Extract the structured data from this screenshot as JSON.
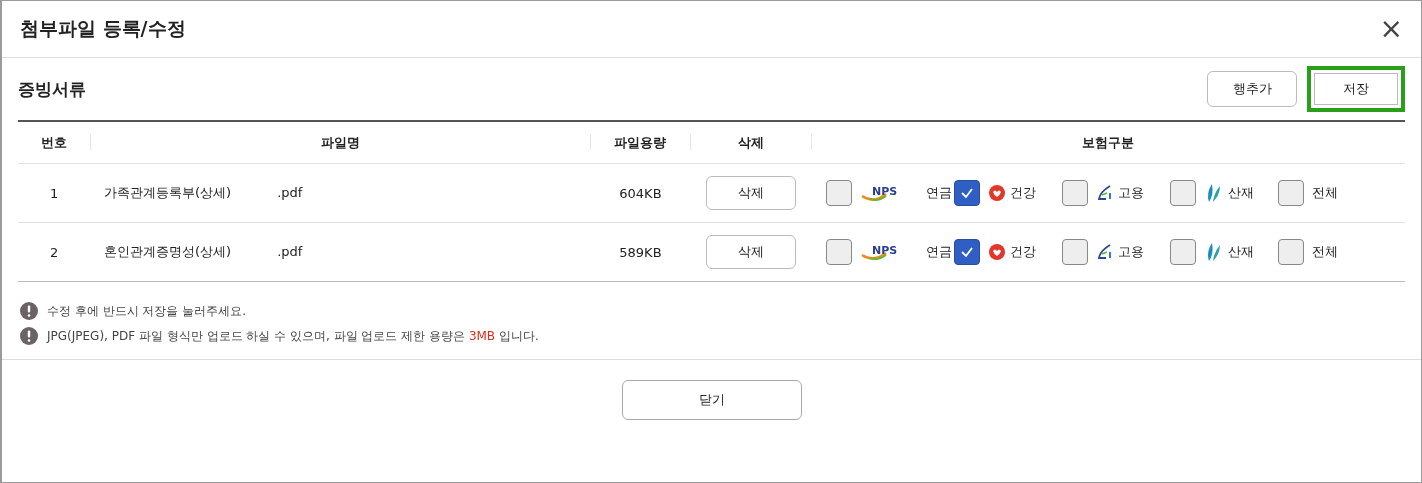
{
  "window": {
    "title": "첨부파일 등록/수정",
    "close": "×"
  },
  "section": {
    "title": "증빙서류",
    "buttons": [
      {
        "label": "행추가",
        "highlighted": false
      },
      {
        "label": "저장",
        "highlighted": true
      }
    ]
  },
  "table": {
    "columns": [
      "번호",
      "파일명",
      "파일용량",
      "삭제",
      "보험구분"
    ],
    "rows": [
      {
        "no": "1",
        "file_name": "가족관계등록부(상세)",
        "file_ext": ".pdf",
        "size": "604KB",
        "delete": "삭제",
        "insurance": [
          {
            "kind": "nps",
            "logo_text": "NPS",
            "label": "연금",
            "checked": false
          },
          {
            "kind": "health",
            "label": "건강",
            "checked": true
          },
          {
            "kind": "employment",
            "label": "고용",
            "checked": false
          },
          {
            "kind": "industrial",
            "label": "산재",
            "checked": false
          },
          {
            "kind": "all",
            "label": "전체",
            "checked": false
          }
        ]
      },
      {
        "no": "2",
        "file_name": "혼인관계증명성(상세)",
        "file_ext": ".pdf",
        "size": "589KB",
        "delete": "삭제",
        "insurance": [
          {
            "kind": "nps",
            "logo_text": "NPS",
            "label": "연금",
            "checked": false
          },
          {
            "kind": "health",
            "label": "건강",
            "checked": true
          },
          {
            "kind": "employment",
            "label": "고용",
            "checked": false
          },
          {
            "kind": "industrial",
            "label": "산재",
            "checked": false
          },
          {
            "kind": "all",
            "label": "전체",
            "checked": false
          }
        ]
      }
    ]
  },
  "notes": [
    "수정 후에 반드시 저장을 눌러주세요.",
    "JPG(JPEG), PDF 파일 형식만 업로드 하실 수 있으며, 파일 업로드 제한 용량은 **3MB** 입니다."
  ],
  "footer": {
    "close_button": "닫기"
  }
}
